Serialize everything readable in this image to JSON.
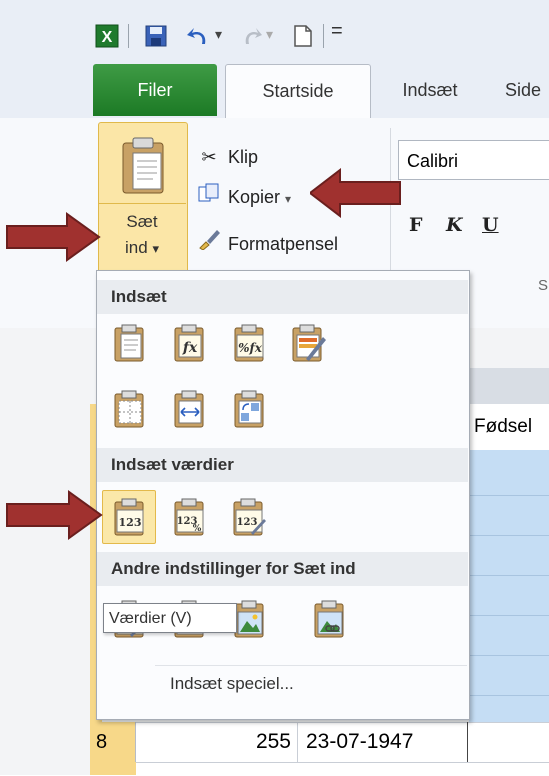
{
  "qat": {
    "separator_glyph": "|",
    "dropdown_glyph": "▾",
    "customize_glyph": "="
  },
  "tabs": {
    "file": "Filer",
    "home": "Startside",
    "insert": "Indsæt",
    "partial": "Side"
  },
  "ribbon": {
    "paste_label_line1": "Sæt",
    "paste_label_line2": "ind",
    "paste_dropdown": "▾",
    "cut": "Klip",
    "copy": "Kopier",
    "format_painter": "Formatpensel",
    "font_name": "Calibri",
    "bold": "F",
    "italic": "K",
    "underline": "U",
    "group_label_partial": "S"
  },
  "paste_menu": {
    "section_paste": "Indsæt",
    "section_values": "Indsæt værdier",
    "section_other": "Andre indstillinger for Sæt ind",
    "paste_special": "Indsæt speciel..."
  },
  "tooltip": "Værdier (V)",
  "sheet": {
    "header_cell": "Fødsel",
    "row8": {
      "row_number": "8",
      "col1": "255",
      "col2": "23-07-1947"
    }
  },
  "colors": {
    "file_tab": "#2a8a33",
    "highlight": "#fbe6a7",
    "arrow": "#a0312f",
    "selection": "#c5ddf4"
  }
}
